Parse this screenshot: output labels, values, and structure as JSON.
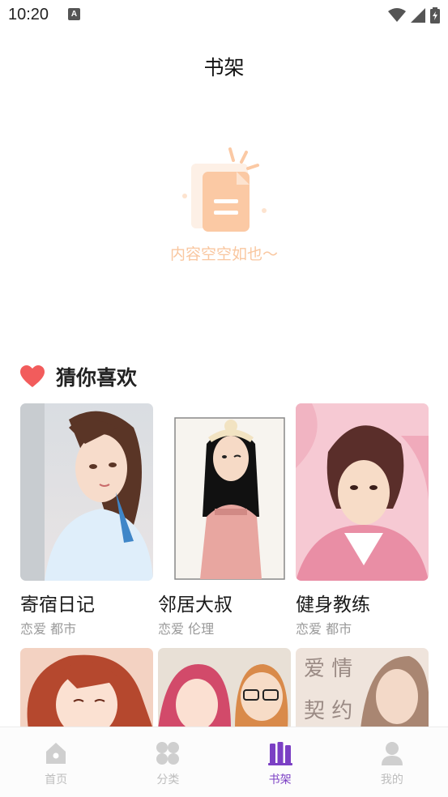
{
  "status_bar": {
    "time": "10:20",
    "notification_icon_letter": "A"
  },
  "header": {
    "title": "书架"
  },
  "empty_state": {
    "message": "内容空空如也～"
  },
  "recommend": {
    "title": "猜你喜欢",
    "books": [
      {
        "title": "寄宿日记",
        "tags": "恋爱 都市"
      },
      {
        "title": "邻居大叔",
        "tags": "恋爱 伦理"
      },
      {
        "title": "健身教练",
        "tags": "恋爱 都市"
      }
    ],
    "partial_cover_text": "爱情契约"
  },
  "nav": {
    "items": [
      {
        "label": "首页",
        "icon": "home-icon"
      },
      {
        "label": "分类",
        "icon": "category-icon"
      },
      {
        "label": "书架",
        "icon": "bookshelf-icon"
      },
      {
        "label": "我的",
        "icon": "profile-icon"
      }
    ],
    "active": "书架"
  },
  "colors": {
    "accent": "#7b3fc4",
    "heart": "#f25c5c",
    "empty_peach": "#f9c7a0",
    "inactive": "#bdbdbd"
  }
}
